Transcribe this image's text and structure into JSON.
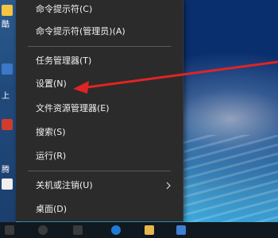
{
  "desktop": {
    "left_text": [
      "酷",
      "上",
      "腾"
    ]
  },
  "menu": {
    "items": [
      {
        "label": "命令提示符(C)"
      },
      {
        "label": "命令提示符(管理员)(A)"
      },
      {
        "label": "任务管理器(T)"
      },
      {
        "label": "设置(N)"
      },
      {
        "label": "文件资源管理器(E)"
      },
      {
        "label": "搜索(S)"
      },
      {
        "label": "运行(R)"
      },
      {
        "label": "关机或注销(U)",
        "has_submenu": true
      },
      {
        "label": "桌面(D)"
      }
    ]
  },
  "annotation": {
    "color": "#e02424",
    "points_to": "设置(N)"
  },
  "taskbar": {
    "icons": [
      "windows-icon",
      "search-icon",
      "task-view-icon",
      "edge-icon",
      "explorer-icon",
      "store-icon"
    ]
  }
}
